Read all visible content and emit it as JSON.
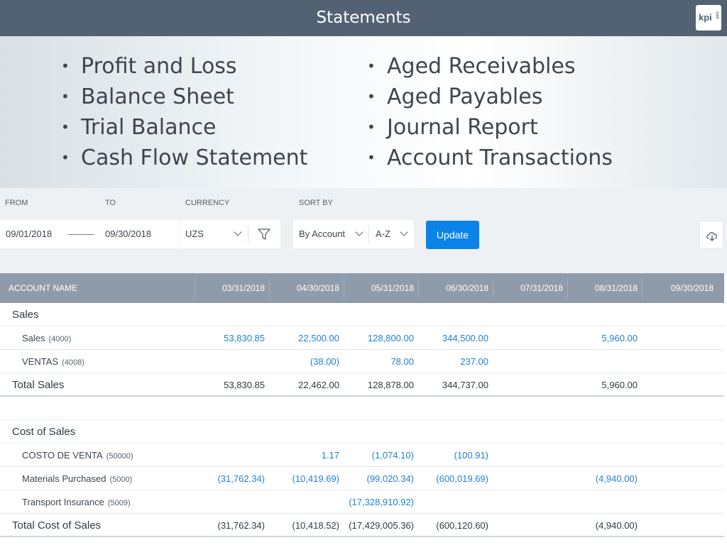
{
  "header": {
    "title": "Statements",
    "logo_text": "kpi",
    "logo_sub": ".com"
  },
  "reports": {
    "left": [
      "Profit and Loss",
      "Balance Sheet",
      "Trial Balance",
      "Cash Flow Statement"
    ],
    "right": [
      "Aged Receivables",
      "Aged Payables",
      "Journal Report",
      "Account Transactions"
    ]
  },
  "filters": {
    "from_label": "FROM",
    "to_label": "TO",
    "currency_label": "CURRENCY",
    "sortby_label": "SORT BY",
    "from_value": "09/01/2018",
    "to_value": "09/30/2018",
    "currency_value": "UZS",
    "sort_value": "By Account",
    "order_value": "A-Z",
    "update_label": "Update"
  },
  "icons": {
    "filter": "filter-icon",
    "download": "cloud-download-icon",
    "chevron": "chevron-down-icon"
  },
  "colors": {
    "topbar": "#536273",
    "accent": "#0a84e8",
    "link_value": "#1d82d6",
    "table_header": "#8e9caa"
  },
  "table": {
    "name_header": "ACCOUNT NAME",
    "columns": [
      "03/31/2018",
      "04/30/2018",
      "05/31/2018",
      "06/30/2018",
      "07/31/2018",
      "08/31/2018",
      "09/30/2018"
    ],
    "rows": [
      {
        "type": "group",
        "name": "Sales",
        "values": [
          "",
          "",
          "",
          "",
          "",
          "",
          ""
        ]
      },
      {
        "type": "account",
        "name": "Sales",
        "code": "(4000)",
        "values": [
          "53,830.85",
          "22,500.00",
          "128,800.00",
          "344,500.00",
          "",
          "5,960.00",
          ""
        ]
      },
      {
        "type": "account",
        "name": "VENTAS",
        "code": "(4008)",
        "values": [
          "",
          "(38.00)",
          "78.00",
          "237.00",
          "",
          "",
          ""
        ]
      },
      {
        "type": "total",
        "name": "Total Sales",
        "values": [
          "53,830.85",
          "22,462.00",
          "128,878.00",
          "344,737.00",
          "",
          "5,960.00",
          ""
        ]
      },
      {
        "type": "spacer",
        "name": "",
        "values": [
          "",
          "",
          "",
          "",
          "",
          "",
          ""
        ]
      },
      {
        "type": "group",
        "name": "Cost of Sales",
        "values": [
          "",
          "",
          "",
          "",
          "",
          "",
          ""
        ]
      },
      {
        "type": "account",
        "name": "COSTO DE VENTA",
        "code": "(50000)",
        "values": [
          "",
          "1.17",
          "(1,074.10)",
          "(100.91)",
          "",
          "",
          ""
        ]
      },
      {
        "type": "account",
        "name": "Materials Purchased",
        "code": "(5000)",
        "values": [
          "(31,762.34)",
          "(10,419.69)",
          "(99,020.34)",
          "(600,019.69)",
          "",
          "(4,940.00)",
          ""
        ]
      },
      {
        "type": "account",
        "name": "Transport Insurance",
        "code": "(5009)",
        "values": [
          "",
          "",
          "(17,328,910.92)",
          "",
          "",
          "",
          ""
        ]
      },
      {
        "type": "total",
        "name": "Total Cost of Sales",
        "values": [
          "(31,762.34)",
          "(10,418.52)",
          "(17,429,005.36)",
          "(600,120.60)",
          "",
          "(4,940.00)",
          ""
        ]
      }
    ]
  }
}
